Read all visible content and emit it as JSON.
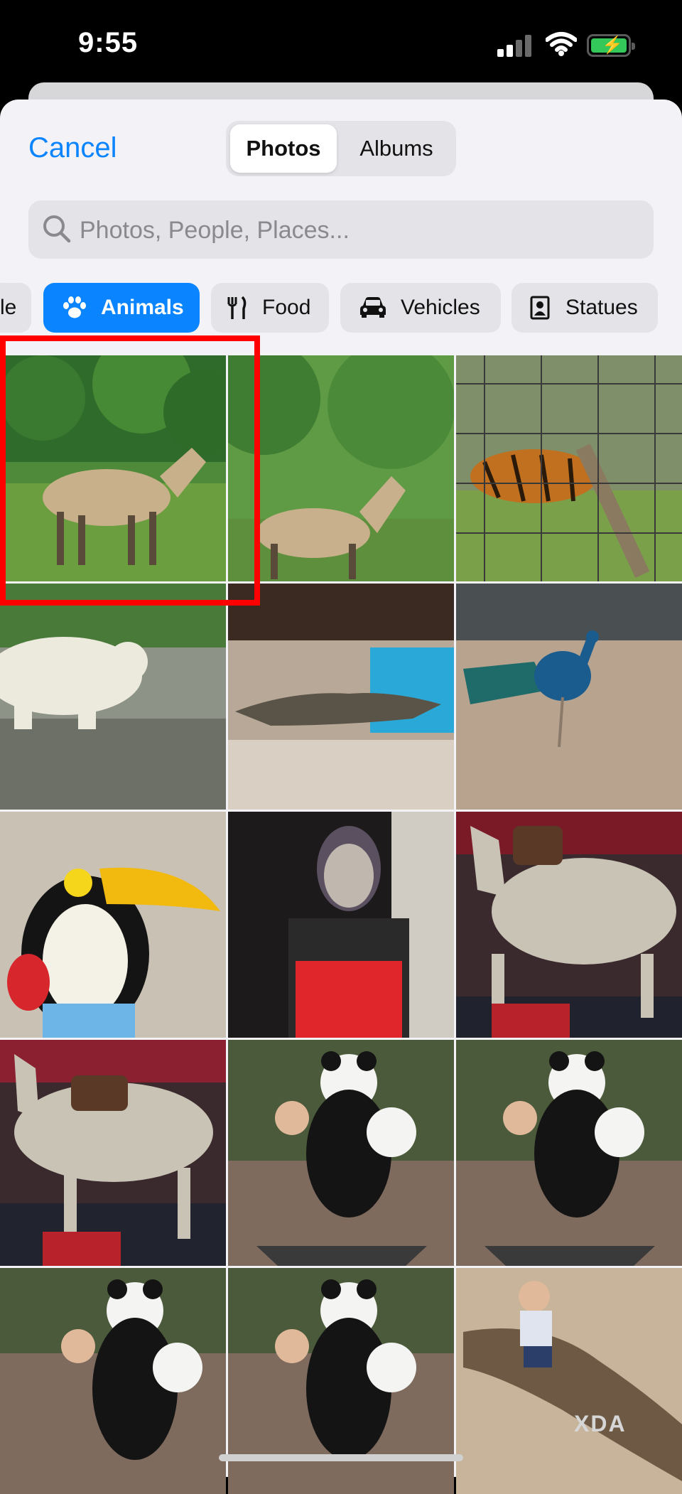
{
  "status_bar": {
    "time": "9:55"
  },
  "header": {
    "cancel_label": "Cancel",
    "tabs": [
      {
        "label": "Photos",
        "selected": true
      },
      {
        "label": "Albums",
        "selected": false
      }
    ]
  },
  "search": {
    "placeholder": "Photos, People, Places..."
  },
  "categories": [
    {
      "label": "le",
      "icon": "",
      "active": false
    },
    {
      "label": "Animals",
      "icon": "paw-icon",
      "active": true
    },
    {
      "label": "Food",
      "icon": "fork-knife-icon",
      "active": false
    },
    {
      "label": "Vehicles",
      "icon": "car-icon",
      "active": false
    },
    {
      "label": "Statues",
      "icon": "statue-frame-icon",
      "active": false
    }
  ],
  "photos": [
    "horse grazing on grass",
    "horse walking by fence",
    "tiger behind wire fence",
    "polar bear walking",
    "iguana on rocks",
    "peacock on patio",
    "toucan plush toy",
    "child wearing skull mask",
    "horse statue with saddle",
    "horse statue with saddle",
    "child hugging panda cutout",
    "child hugging panda cutout",
    "child hugging panda cutout",
    "child hugging panda cutout",
    "child sitting on crocodile statue"
  ],
  "highlight": {
    "color": "#ff0000",
    "target": "photo-1"
  },
  "watermark": "XDA",
  "colors": {
    "accent": "#0a84ff",
    "sheet": "#f2f2f7"
  }
}
